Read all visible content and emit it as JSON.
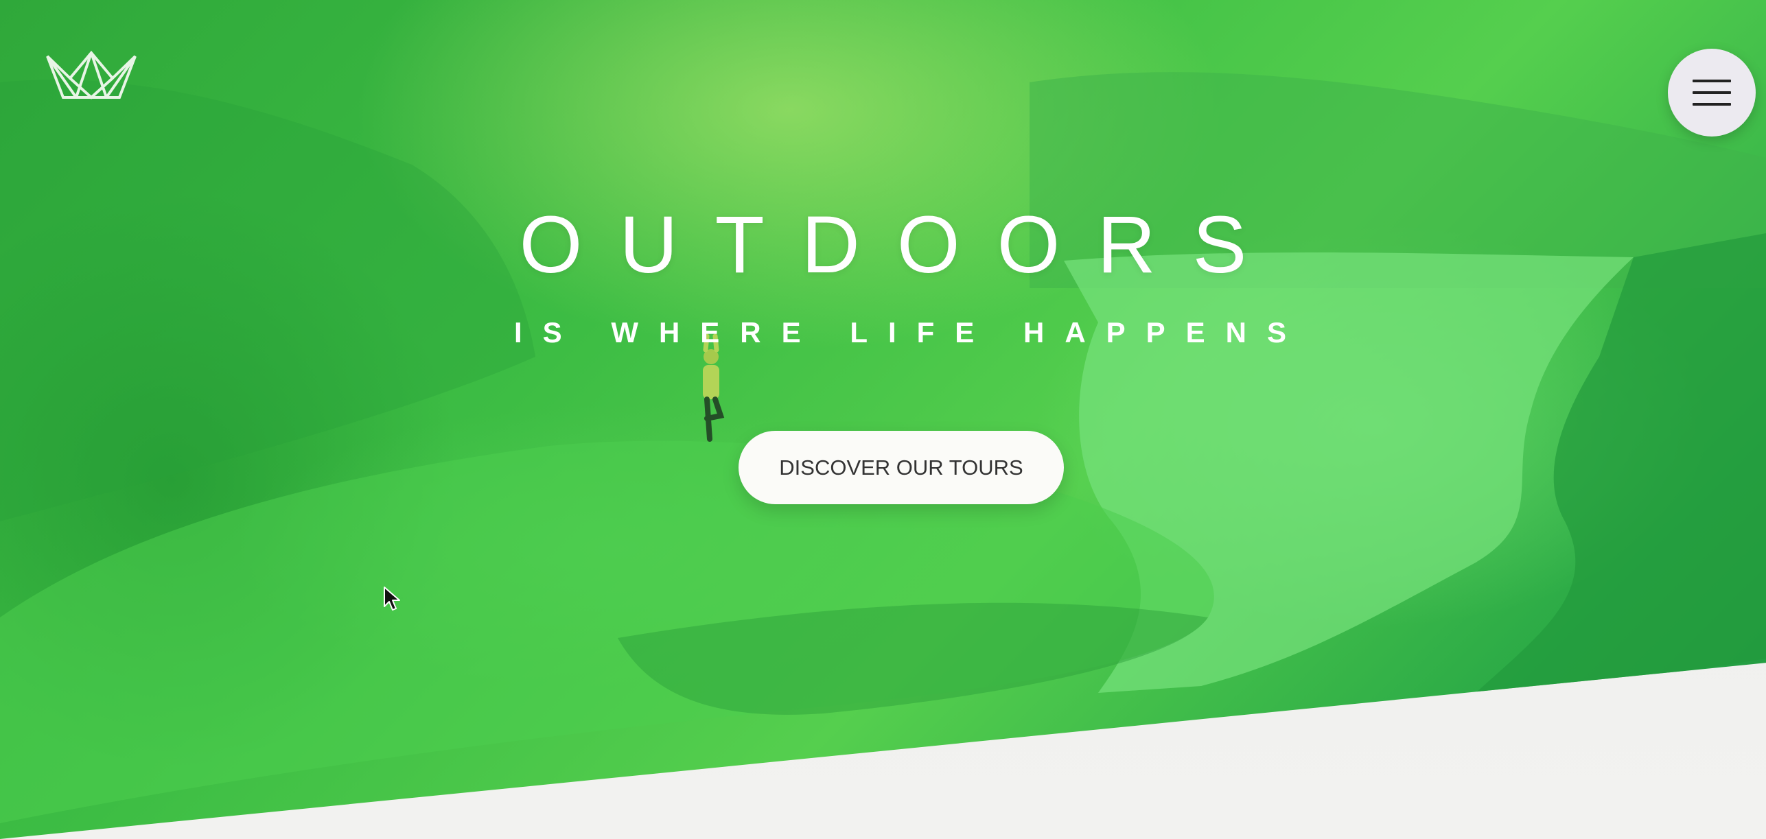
{
  "header": {
    "logo_icon": "crown-icon",
    "menu_icon": "hamburger-icon"
  },
  "hero": {
    "title": "OUTDOORS",
    "subtitle": "IS WHERE LIFE HAPPENS",
    "cta_label": "DISCOVER OUR TOURS"
  },
  "colors": {
    "hero_tint": "#3dbd44",
    "cta_background": "#fbfbf8",
    "menu_button_background": "#eceaf0"
  }
}
